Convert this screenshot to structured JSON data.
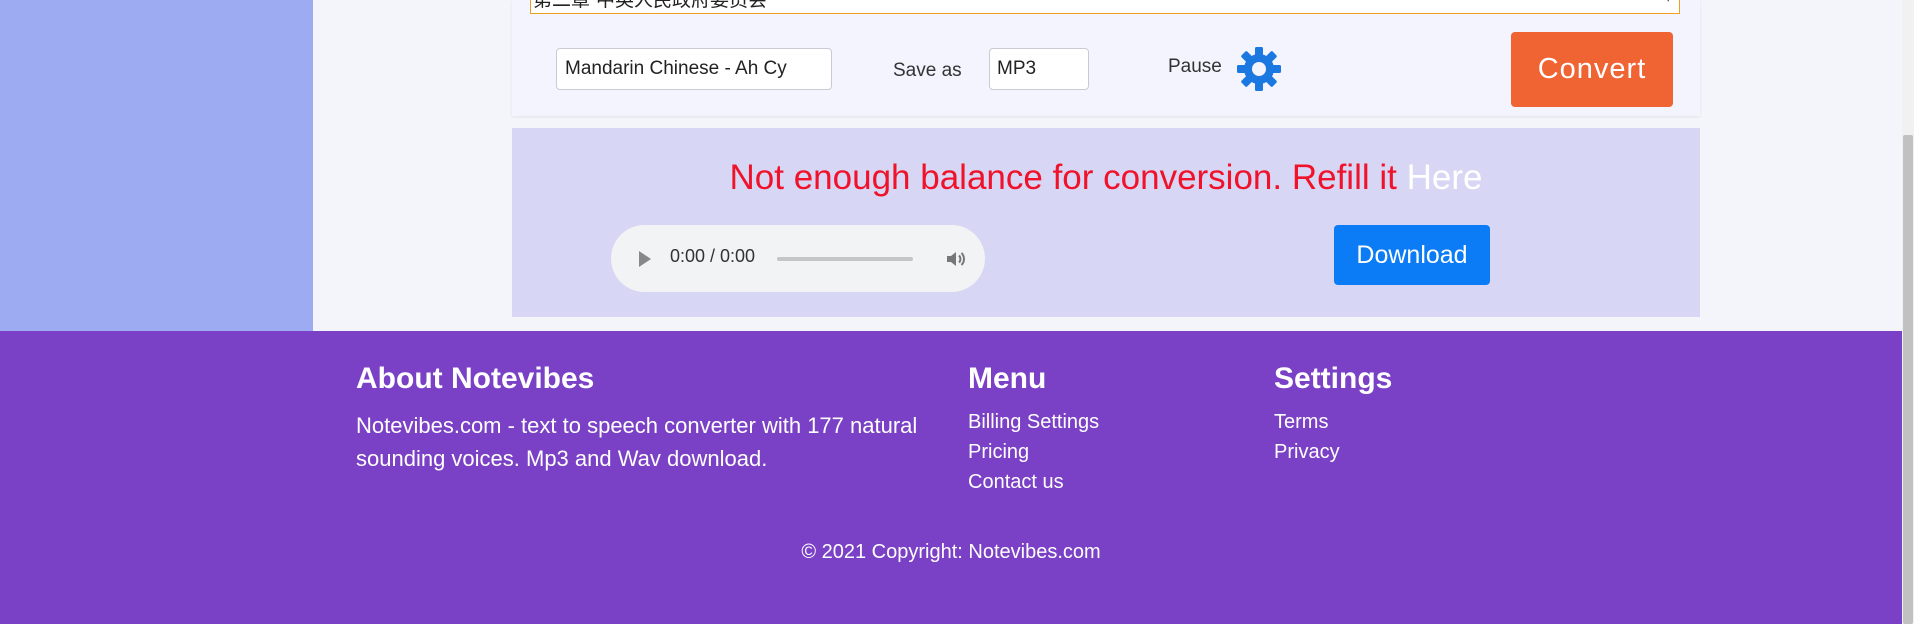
{
  "converter": {
    "text_preview": "第二章 中英人民政府委员会",
    "voice_value": "Mandarin Chinese - Ah Cy",
    "save_as_label": "Save as",
    "format_value": "MP3",
    "pause_label": "Pause",
    "convert_label": "Convert"
  },
  "result": {
    "message": "Not enough balance for conversion. Refill it ",
    "refill_link": "Here",
    "audio_time": "0:00 / 0:00",
    "audio_progress": 0,
    "download_label": "Download"
  },
  "footer": {
    "about": {
      "heading": "About Notevibes",
      "text": "Notevibes.com - text to speech converter with 177 natural sounding voices. Mp3 and Wav download."
    },
    "menu": {
      "heading": "Menu",
      "items": [
        "Billing Settings",
        "Pricing",
        "Contact us"
      ]
    },
    "settings": {
      "heading": "Settings",
      "items": [
        "Terms",
        "Privacy"
      ]
    },
    "copyright": "© 2021 Copyright: Notevibes.com"
  },
  "colors": {
    "sidebar": "#9dabf3",
    "convert_button": "#f06333",
    "download_button": "#0b7cf5",
    "error_text": "#f0122a",
    "footer": "#7a40c5"
  },
  "icons": [
    "gear-icon",
    "play-icon",
    "volume-icon"
  ]
}
